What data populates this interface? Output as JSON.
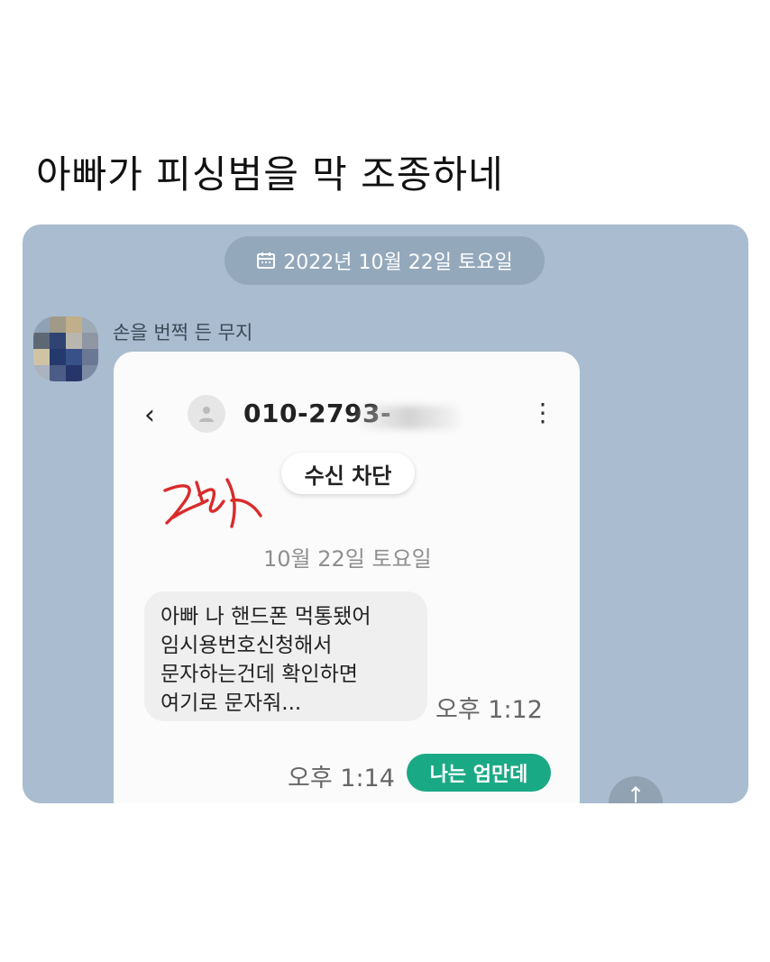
{
  "post": {
    "title": "아빠가 피싱범을 막 조종하네"
  },
  "chat": {
    "date": "2022년 10월 22일 토요일",
    "sender": "손을 번쩍 든 무지"
  },
  "screenshot": {
    "phone_number": "010-2793-",
    "block_button": "수신 차단",
    "date": "10월 22일 토요일",
    "messages": {
      "incoming_lines": [
        "아빠 나 핸드폰 먹통됐어",
        "임시용번호신청해서",
        "문자하는건데 확인하면",
        "여기로 문자줘..."
      ],
      "incoming_time": "오후 1:12",
      "outgoing_text": "나는 엄만데",
      "outgoing_time": "오후 1:14"
    }
  },
  "icons": [
    "calendar-icon",
    "back-chevron-icon",
    "person-icon",
    "more-vertical-icon",
    "scroll-up-icon"
  ],
  "colors": {
    "chat_background": "#a9bcd0",
    "reply_green": "#1aa985",
    "signature_red": "#d92b2b"
  }
}
